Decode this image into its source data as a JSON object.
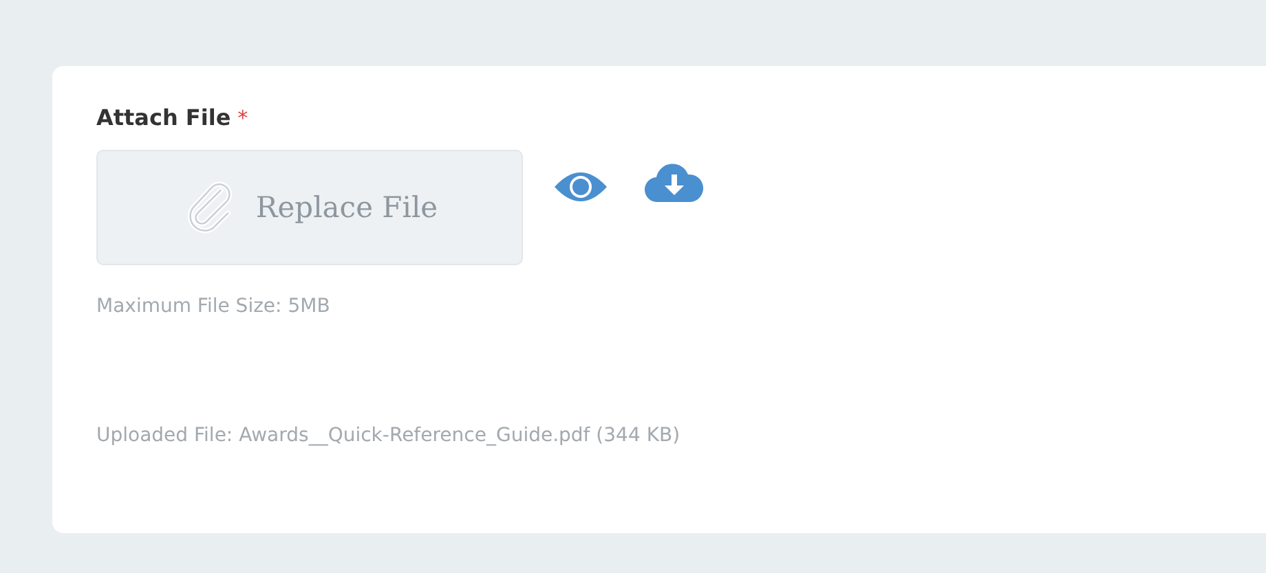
{
  "field": {
    "label": "Attach File",
    "required_mark": "*",
    "button": {
      "label": "Replace File",
      "disabled": true
    },
    "hint": "Maximum File Size: 5MB",
    "uploaded": "Uploaded File: Awards__Quick-Reference_Guide.pdf (344 KB)"
  }
}
